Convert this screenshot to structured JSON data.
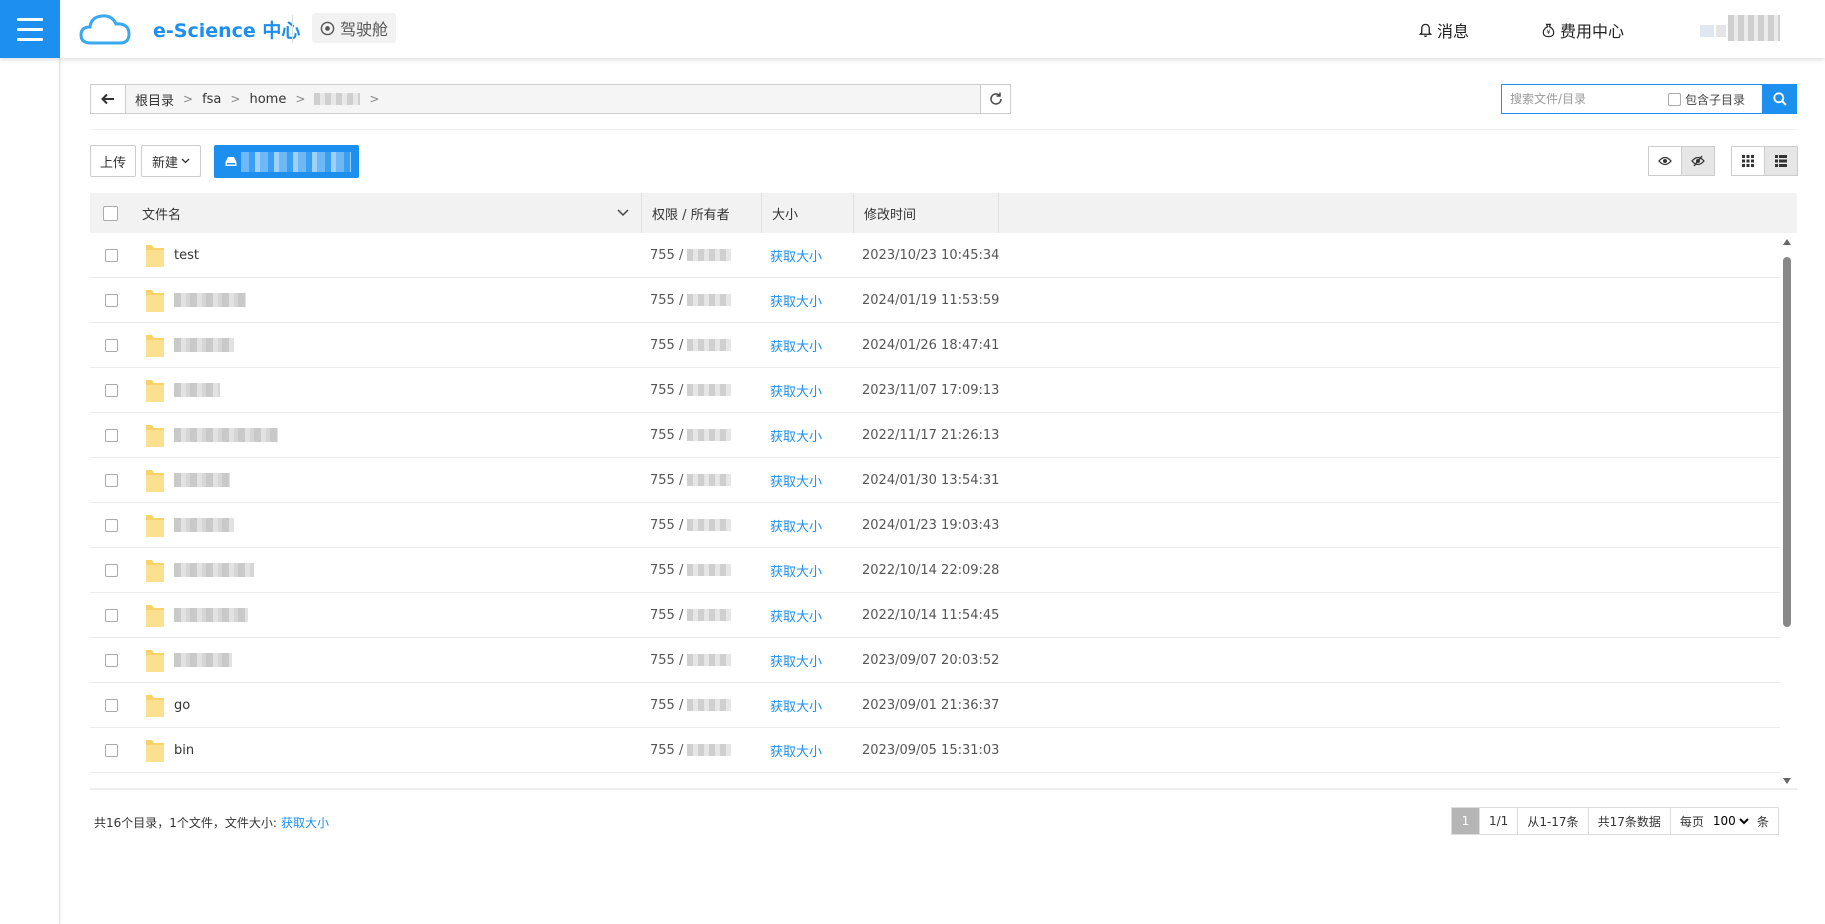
{
  "header": {
    "brand": "e-Science 中心",
    "cockpit": "驾驶舱",
    "messages": "消息",
    "billing": "费用中心"
  },
  "path": {
    "crumbs": [
      "根目录",
      "fsa",
      "home"
    ]
  },
  "search": {
    "placeholder": "搜索文件/目录",
    "include_subdirs": "包含子目录"
  },
  "toolbar": {
    "upload": "上传",
    "new": "新建"
  },
  "table": {
    "columns": [
      "文件名",
      "权限 / 所有者",
      "大小",
      "修改时间"
    ],
    "rows": [
      {
        "name": "test",
        "perm": "755 /",
        "size": "获取大小",
        "mtime": "2023/10/23 10:45:34"
      },
      {
        "name": "",
        "perm": "755 /",
        "size": "获取大小",
        "mtime": "2024/01/19 11:53:59"
      },
      {
        "name": "",
        "perm": "755 /",
        "size": "获取大小",
        "mtime": "2024/01/26 18:47:41"
      },
      {
        "name": "",
        "perm": "755 /",
        "size": "获取大小",
        "mtime": "2023/11/07 17:09:13"
      },
      {
        "name": "",
        "perm": "755 /",
        "size": "获取大小",
        "mtime": "2022/11/17 21:26:13"
      },
      {
        "name": "",
        "perm": "755 /",
        "size": "获取大小",
        "mtime": "2024/01/30 13:54:31"
      },
      {
        "name": "",
        "perm": "755 /",
        "size": "获取大小",
        "mtime": "2024/01/23 19:03:43"
      },
      {
        "name": "",
        "perm": "755 /",
        "size": "获取大小",
        "mtime": "2022/10/14 22:09:28"
      },
      {
        "name": "",
        "perm": "755 /",
        "size": "获取大小",
        "mtime": "2022/10/14 11:54:45"
      },
      {
        "name": "",
        "perm": "755 /",
        "size": "获取大小",
        "mtime": "2023/09/07 20:03:52"
      },
      {
        "name": "go",
        "perm": "755 /",
        "size": "获取大小",
        "mtime": "2023/09/01 21:36:37"
      },
      {
        "name": "bin",
        "perm": "755 /",
        "size": "获取大小",
        "mtime": "2023/09/05 15:31:03"
      }
    ]
  },
  "footer": {
    "summary": "共16个目录，1个文件，文件大小:",
    "summary_link": "获取大小",
    "pager": {
      "current": "1",
      "pages": "1/1",
      "range": "从1-17条",
      "total": "共17条数据",
      "per_page_label": "每页",
      "per_page_value": "100",
      "unit": "条"
    }
  },
  "colors": {
    "accent": "#1c8fef",
    "folder": "#f8d36a"
  }
}
